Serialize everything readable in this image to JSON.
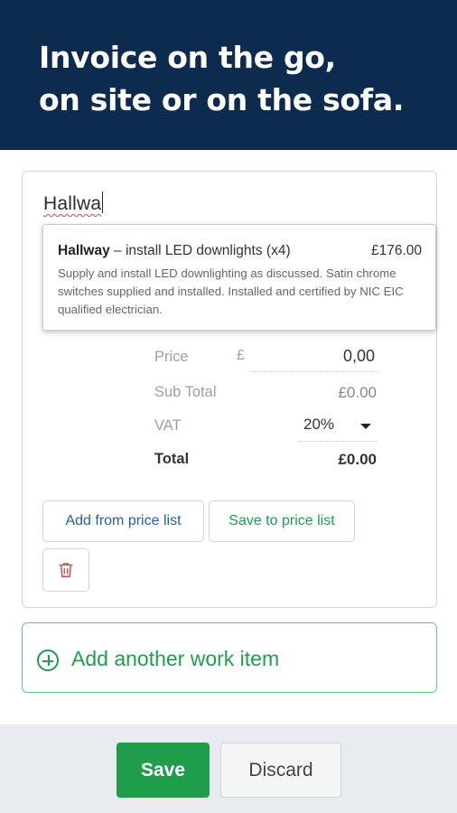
{
  "banner": {
    "line1": "Invoice on the go,",
    "line2": "on site or on the sofa."
  },
  "work_item": {
    "description_value": "Hallwa",
    "suggestion": {
      "title_bold": "Hallway",
      "title_rest": " – install LED downlights (x4)",
      "amount": "£176.00",
      "body": "Supply and install LED downlighting as discussed. Satin chrome switches supplied and installed. Installed and certified by NIC EIC qualified electrician."
    },
    "price": {
      "label": "Price",
      "currency": "£",
      "value": "0,00"
    },
    "sub_total": {
      "label": "Sub Total",
      "value": "£0.00"
    },
    "vat": {
      "label": "VAT",
      "value": "20%"
    },
    "total": {
      "label": "Total",
      "value": "£0.00"
    },
    "buttons": {
      "add_from_price_list": "Add from price list",
      "save_to_price_list": "Save to price list"
    }
  },
  "add_item": {
    "label": "Add another work item"
  },
  "footer": {
    "save_label": "Save",
    "discard_label": "Discard"
  },
  "colors": {
    "banner": "#0d2b4e",
    "accent_green": "#1f9d4b",
    "link_blue": "#2a5d9f",
    "danger_red": "#e0505a",
    "footer_bg": "#e8ecf1"
  },
  "icons": {
    "delete": "trash-icon",
    "add": "plus-circle-icon",
    "vat_dropdown": "caret-down-icon"
  }
}
